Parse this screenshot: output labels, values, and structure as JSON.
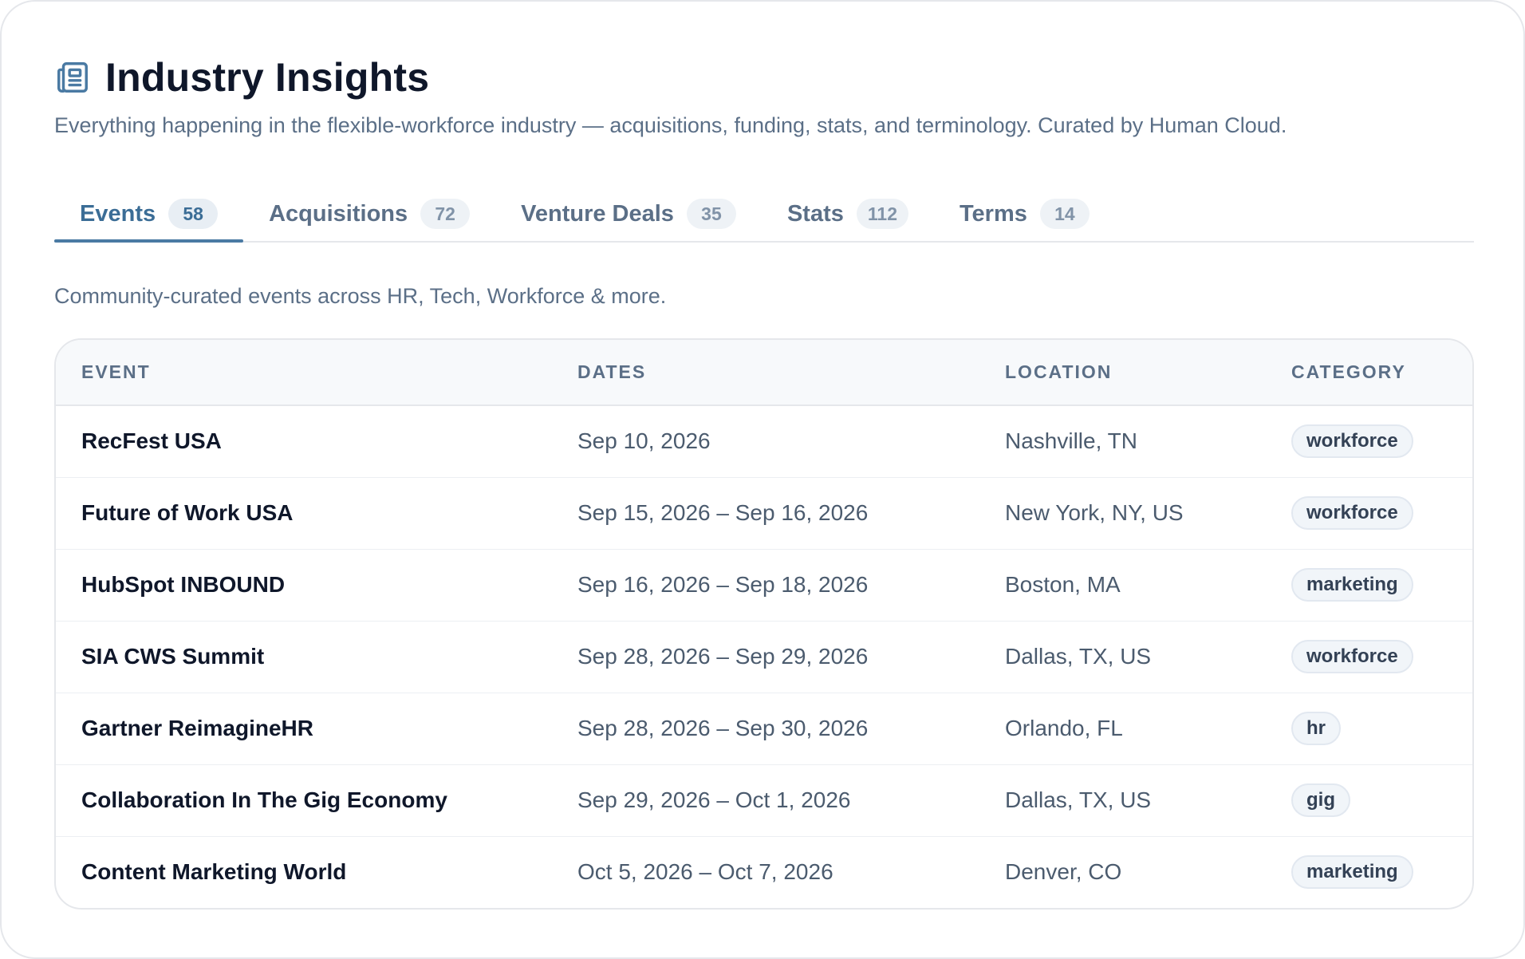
{
  "header": {
    "icon": "newspaper-icon",
    "title": "Industry Insights",
    "subtitle": "Everything happening in the flexible-workforce industry — acquisitions, funding, stats, and terminology. Curated by Human Cloud."
  },
  "tabs": [
    {
      "label": "Events",
      "count": "58",
      "active": true
    },
    {
      "label": "Acquisitions",
      "count": "72"
    },
    {
      "label": "Venture Deals",
      "count": "35"
    },
    {
      "label": "Stats",
      "count": "112"
    },
    {
      "label": "Terms",
      "count": "14"
    }
  ],
  "section": {
    "description": "Community-curated events across HR, Tech, Workforce & more."
  },
  "table": {
    "columns": [
      "EVENT",
      "DATES",
      "LOCATION",
      "CATEGORY"
    ],
    "rows": [
      {
        "event": "RecFest USA",
        "dates": "Sep 10, 2026",
        "location": "Nashville, TN",
        "category": "workforce"
      },
      {
        "event": "Future of Work USA",
        "dates": "Sep 15, 2026 – Sep 16, 2026",
        "location": "New York, NY, US",
        "category": "workforce"
      },
      {
        "event": "HubSpot INBOUND",
        "dates": "Sep 16, 2026 – Sep 18, 2026",
        "location": "Boston, MA",
        "category": "marketing"
      },
      {
        "event": "SIA CWS Summit",
        "dates": "Sep 28, 2026 – Sep 29, 2026",
        "location": "Dallas, TX, US",
        "category": "workforce"
      },
      {
        "event": "Gartner ReimagineHR",
        "dates": "Sep 28, 2026 – Sep 30, 2026",
        "location": "Orlando, FL",
        "category": "hr"
      },
      {
        "event": "Collaboration In The Gig Economy",
        "dates": "Sep 29, 2026 – Oct 1, 2026",
        "location": "Dallas, TX, US",
        "category": "gig"
      },
      {
        "event": "Content Marketing World",
        "dates": "Oct 5, 2026 – Oct 7, 2026",
        "location": "Denver, CO",
        "category": "marketing"
      }
    ]
  },
  "colors": {
    "accent": "#4a7aa3",
    "muted_text": "#5b6f87",
    "title_text": "#0f172a",
    "border": "#e5e7eb"
  }
}
